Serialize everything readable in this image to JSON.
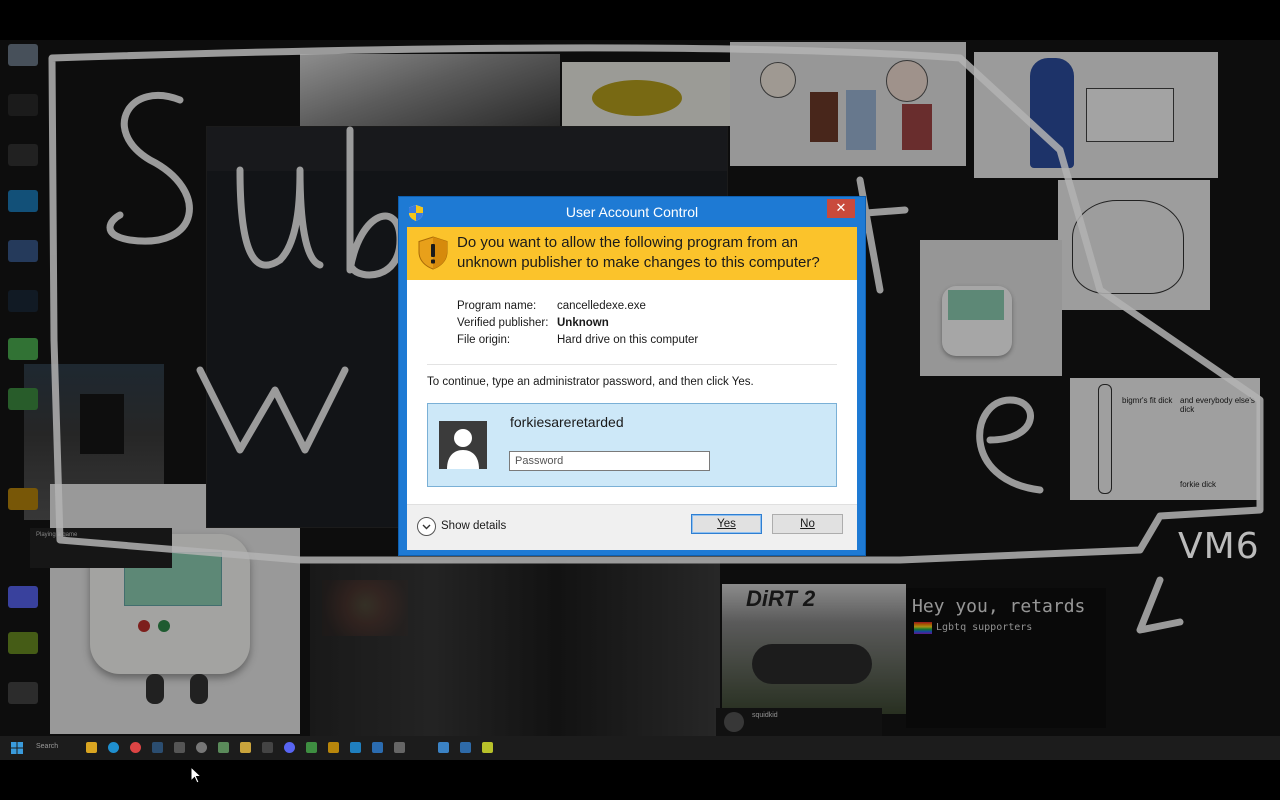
{
  "desktop": {
    "scribble_text": [
      "Sub",
      "to",
      "wh",
      "ere"
    ],
    "vm_label": "VM6",
    "hey_banner": "Hey you, retards",
    "lgbt_line": "Lgbtq supporters",
    "dirt_logo": "DiRT 2",
    "doodle_caption_1": "bigmr's fit dick",
    "doodle_caption_2": "and everybody else's dick",
    "doodle_caption_3": "forkie dick",
    "playing_label": "Playing a game",
    "chat_user": "squidkid",
    "taskbar_search": "Search",
    "colors": {
      "desktop_bg": "#141414",
      "scribble": "#bfbfbf"
    }
  },
  "uac": {
    "title": "User Account Control",
    "close_label": "✕",
    "question": "Do you want to allow the following program from an unknown publisher to make changes to this computer?",
    "program_name_label": "Program name:",
    "program_name": "cancelledexe.exe",
    "publisher_label": "Verified publisher:",
    "publisher": "Unknown",
    "origin_label": "File origin:",
    "origin": "Hard drive on this computer",
    "instruction": "To continue, type an administrator password, and then click Yes.",
    "username": "forkiesareretarded",
    "password_placeholder": "Password",
    "details_label": "Show details",
    "yes_label": "Yes",
    "no_label": "No",
    "colors": {
      "frame": "#1e7ad4",
      "banner": "#fbc32b",
      "credential_bg": "#cde8f8",
      "close": "#c94a3c"
    }
  }
}
